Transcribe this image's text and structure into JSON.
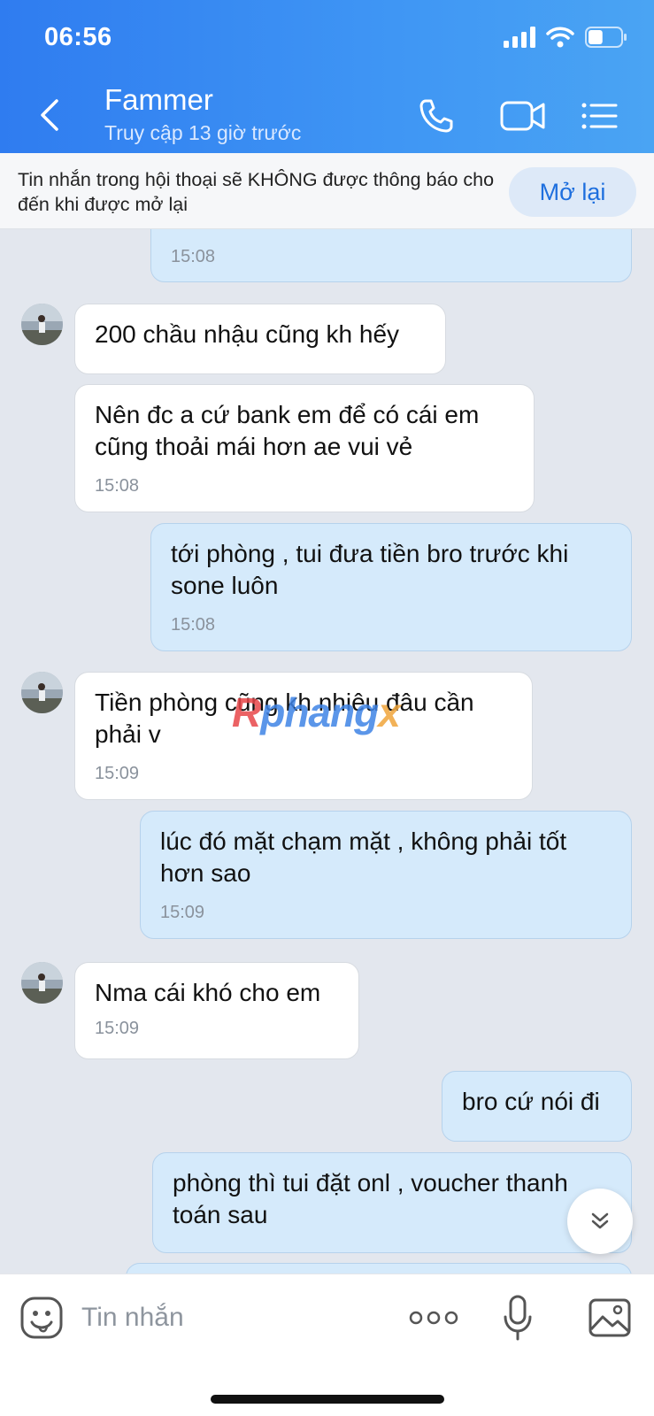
{
  "status_bar": {
    "time": "06:56",
    "battery_level": 0.45
  },
  "header": {
    "title": "Fammer",
    "subtitle": "Truy cập 13 giờ trước",
    "icons": [
      "back-icon",
      "phone-icon",
      "video-call-icon",
      "menu-list-icon"
    ]
  },
  "notice": {
    "text": "Tin nhắn trong hội thoại sẽ KHÔNG được thông báo cho đến khi được mở lại",
    "button": "Mở lại"
  },
  "messages": [
    {
      "dir": "out",
      "text": "",
      "time": "15:08"
    },
    {
      "dir": "in",
      "text": "200 chầu nhậu cũng kh hếy",
      "time": ""
    },
    {
      "dir": "in",
      "text": "Nên đc a cứ bank em để có cái em cũng thoải mái hơn ae vui vẻ",
      "time": "15:08"
    },
    {
      "dir": "out",
      "text": "tới phòng , tui đưa tiền bro  trước khi sone luôn",
      "time": "15:08"
    },
    {
      "dir": "in",
      "text": "Tiền phòng cũng kh nhiêu đâu cần phải v",
      "time": "15:09"
    },
    {
      "dir": "out",
      "text": "lúc đó mặt chạm mặt , không phải tốt hơn sao",
      "time": "15:09"
    },
    {
      "dir": "in",
      "text": "Nma cái khó cho em",
      "time": "15:09"
    },
    {
      "dir": "out",
      "text": "bro cứ nói đi",
      "time": ""
    },
    {
      "dir": "out",
      "text": "phòng thì tui đặt onl , voucher thanh toán sau",
      "time": ""
    }
  ],
  "watermark": {
    "part1": "R",
    "part2": "phang",
    "part3": "x"
  },
  "composer": {
    "placeholder": "Tin nhắn"
  },
  "colors": {
    "header_start": "#2f7cf0",
    "header_end": "#4aa4f3",
    "accent": "#1e6fde",
    "bubble_out": "#d5eafb",
    "bubble_in": "#ffffff"
  }
}
